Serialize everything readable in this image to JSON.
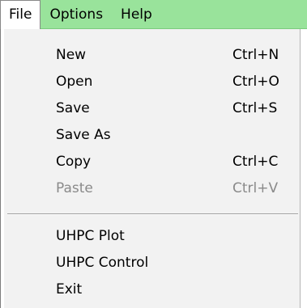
{
  "menubar": {
    "items": [
      {
        "label": "File"
      },
      {
        "label": "Options"
      },
      {
        "label": "Help"
      }
    ]
  },
  "file_menu": {
    "items": [
      {
        "label": "New",
        "shortcut": "Ctrl+N",
        "enabled": true
      },
      {
        "label": "Open",
        "shortcut": "Ctrl+O",
        "enabled": true
      },
      {
        "label": "Save",
        "shortcut": "Ctrl+S",
        "enabled": true
      },
      {
        "label": "Save As",
        "shortcut": "",
        "enabled": true
      },
      {
        "label": "Copy",
        "shortcut": "Ctrl+C",
        "enabled": true
      },
      {
        "label": "Paste",
        "shortcut": "Ctrl+V",
        "enabled": false
      }
    ],
    "items_after_separator": [
      {
        "label": "UHPC Plot",
        "enabled": true
      },
      {
        "label": "UHPC Control",
        "enabled": true
      },
      {
        "label": "Exit",
        "enabled": true
      }
    ]
  },
  "colors": {
    "menubar_bg": "#99e39b",
    "menu_bg": "#f2f2f2",
    "disabled_text": "#8a8a8a"
  }
}
